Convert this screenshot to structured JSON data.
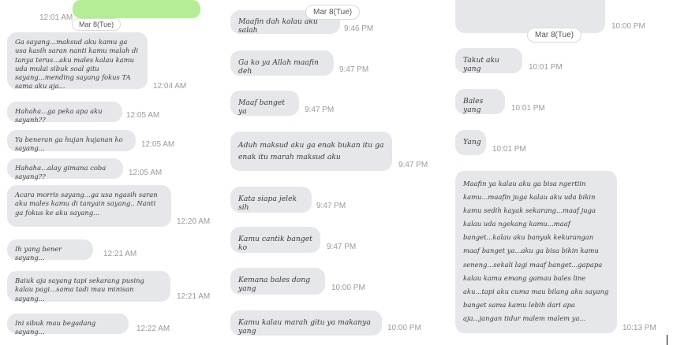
{
  "col1": {
    "top_green_time": "12:01 AM",
    "date_chip": "Mar 8(Tue)",
    "messages": [
      {
        "text": "Ga sayang...maksud aku kamu ga usa kasih saran nanti kamu malah di tanya terus...aku males kalau kamu uda mulai sibuk soal gitu sayang...mending sayang fokus TA sama aku aja...",
        "time": "12:04 AM"
      },
      {
        "text": "Hahaha...ga peka apa aku sayanh??",
        "time": "12:05 AM"
      },
      {
        "text": "Ya beneran ga hujan hujanan ko sayang...",
        "time": "12:05 AM"
      },
      {
        "text": "Hahaha...alay gimana coba sayang??",
        "time": "12:05 AM"
      },
      {
        "text": "Acara morris sayang...ga usa ngasih saran aku males kamu di tanyain sayang.. Nanti ga fokus ke aku sayang...",
        "time": "12:20 AM"
      },
      {
        "text": "Ih yang bener sayang...",
        "time": "12:21 AM"
      },
      {
        "text": "Baiuk aja sayang tapi sekarang pusing kalau pagi...sama tadi mau minisan sayang...",
        "time": "12:21 AM"
      },
      {
        "text": "Ini sibuk mau begadang sayang...",
        "time": "12:22 AM"
      }
    ]
  },
  "col2": {
    "date_chip": "Mar 8(Tue)",
    "messages": [
      {
        "text": "Maafin dah kalau aku salah",
        "time": "9:46 PM"
      },
      {
        "text": "Ga ko ya Allah maafin deh",
        "time": "9:47 PM"
      },
      {
        "text": "Maaf banget ya",
        "time": "9:47 PM"
      },
      {
        "text": "Aduh maksud aku ga enak bukan itu ga enak itu marah maksud aku",
        "time": "9:47 PM"
      },
      {
        "text": "Kata siapa jelek sih",
        "time": "9:47 PM"
      },
      {
        "text": "Kamu cantik banget ko",
        "time": "9:47 PM"
      },
      {
        "text": "Kemana bales dong yang",
        "time": "10:00 PM"
      },
      {
        "text": "Kamu kalau marah gitu ya makanya yang",
        "time": "10:00 PM"
      }
    ]
  },
  "col3": {
    "top_time": "10:00 PM",
    "date_chip": "Mar 8(Tue)",
    "messages": [
      {
        "text": "Takut aku yang",
        "time": "10:01 PM"
      },
      {
        "text": "Bales yang",
        "time": "10:01 PM"
      },
      {
        "text": "Yang",
        "time": "10:01 PM"
      },
      {
        "text": "Maafin ya kalau aku ga bisa ngertiin kamu...maafin juga kalau aku uda bikin kamu sedih kayak sekarang...maaf juga kalau uda ngekang kamu...maaf banget...kalau aku banyak kekurangan maaf banget ya...aku ga bisa bikin kamu seneng...sekali lagi maaf banget...gapapa kalau kamu emang gamau bales line aku...tapi aku cuma mau bilang aku sayang banget sama kamu lebih dari apa aja...jangan tidur malem malem ya...",
        "time": "10:13 PM"
      }
    ]
  }
}
